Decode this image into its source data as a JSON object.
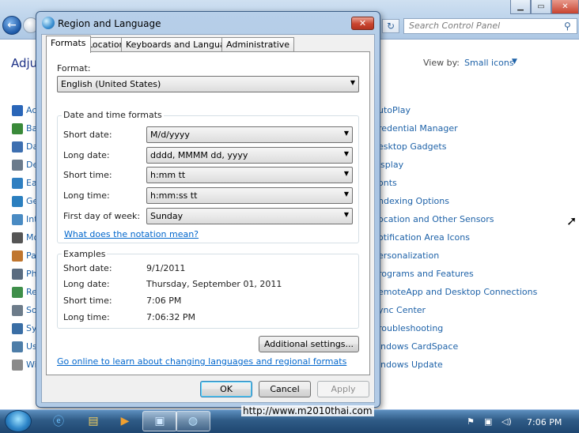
{
  "control_panel": {
    "search_placeholder": "Search Control Panel",
    "heading": "Adju",
    "view_by_label": "View by:",
    "view_by_value": "Small icons",
    "left_items": [
      "Ac",
      "Ba",
      "Da",
      "De",
      "Ea",
      "Ge",
      "Int",
      "Mo",
      "Pa",
      "Ph",
      "Re",
      "So",
      "Sy",
      "Us",
      "Wi"
    ],
    "right_items": [
      "utoPlay",
      "redential Manager",
      "esktop Gadgets",
      "isplay",
      "onts",
      "ndexing Options",
      "ocation and Other Sensors",
      "otification Area Icons",
      "ersonalization",
      "rograms and Features",
      "emoteApp and Desktop Connections",
      "ync Center",
      "roubleshooting",
      "indows CardSpace",
      "indows Update"
    ]
  },
  "dialog": {
    "title": "Region and Language",
    "tabs": [
      "Formats",
      "Location",
      "Keyboards and Languages",
      "Administrative"
    ],
    "format_label": "Format:",
    "format_value": "English (United States)",
    "date_time_group_title": "Date and time formats",
    "fields": [
      {
        "label": "Short date:",
        "value": "M/d/yyyy"
      },
      {
        "label": "Long date:",
        "value": "dddd, MMMM dd, yyyy"
      },
      {
        "label": "Short time:",
        "value": "h:mm tt"
      },
      {
        "label": "Long time:",
        "value": "h:mm:ss tt"
      },
      {
        "label": "First day of week:",
        "value": "Sunday"
      }
    ],
    "notation_link": "What does the notation mean?",
    "examples_title": "Examples",
    "examples": [
      {
        "label": "Short date:",
        "value": "9/1/2011"
      },
      {
        "label": "Long date:",
        "value": "Thursday, September 01, 2011"
      },
      {
        "label": "Short time:",
        "value": "7:06 PM"
      },
      {
        "label": "Long time:",
        "value": "7:06:32 PM"
      }
    ],
    "additional_settings_label": "Additional settings...",
    "online_link": "Go online to learn about changing languages and regional formats",
    "ok_label": "OK",
    "cancel_label": "Cancel",
    "apply_label": "Apply"
  },
  "taskbar": {
    "watermark": "http://www.m2010thai.com",
    "clock": "7:06 PM"
  },
  "colors": {
    "link": "#0066cc",
    "accent": "#1e62a8",
    "taskbar": "#2f5b86"
  }
}
